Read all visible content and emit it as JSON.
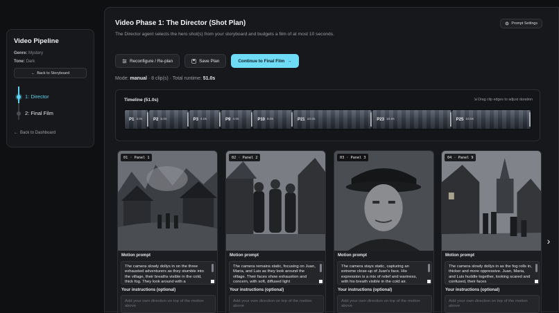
{
  "sidebar": {
    "title": "Video Pipeline",
    "genre_label": "Genre:",
    "genre": "Mystery",
    "tone_label": "Tone:",
    "tone": "Dark",
    "back_storyboard": "Back to Storyboard",
    "steps": [
      {
        "label": "1: Director",
        "active": true
      },
      {
        "label": "2: Final Film",
        "active": false
      }
    ],
    "back_dashboard": "Back to Dashboard"
  },
  "header": {
    "title": "Video Phase 1: The Director (Shot Plan)",
    "description": "The Director agent selects the hero shot(s) from your storyboard and budgets a film of at most 10 seconds.",
    "prompt_settings": "Prompt Settings"
  },
  "actions": {
    "reconfigure": "Reconfigure / Re-plan",
    "save": "Save Plan",
    "continue": "Continue to Final Film"
  },
  "status": {
    "mode_label": "Mode:",
    "mode": "manual",
    "clips": "8 clip(s)",
    "runtime_label": "Total runtime:",
    "runtime": "51.0s"
  },
  "timeline": {
    "title": "Timeline (51.0s)",
    "hint": "Drag clip edges to adjust duration",
    "clips": [
      {
        "name": "P1",
        "duration": "3.0s",
        "seconds": 3.0
      },
      {
        "name": "P2",
        "duration": "5.0s",
        "seconds": 5.0
      },
      {
        "name": "P3",
        "duration": "4.0s",
        "seconds": 4.0
      },
      {
        "name": "P9",
        "duration": "4.0s",
        "seconds": 4.0
      },
      {
        "name": "P10",
        "duration": "5.0s",
        "seconds": 5.0
      },
      {
        "name": "P21",
        "duration": "10.0s",
        "seconds": 10.0
      },
      {
        "name": "P23",
        "duration": "10.0s",
        "seconds": 10.0
      },
      {
        "name": "P25",
        "duration": "10.0s",
        "seconds": 10.0
      }
    ]
  },
  "cards": [
    {
      "badge": "01 · Panel 1",
      "motion_label": "Motion prompt",
      "motion": "The camera slowly dollys in on the three exhausted adventurers as they stumble into the village, their breaths visible in the cold, thick fog. They look around with a",
      "instructions_label": "Your instructions (optional)",
      "instructions_placeholder": "Add your own direction on top of the motion above"
    },
    {
      "badge": "02 · Panel 2",
      "motion_label": "Motion prompt",
      "motion": "The camera remains static, focusing on Juan, Maria, and Luis as they look around the village. Their faces show exhaustion and concern, with soft, diffused light",
      "instructions_label": "Your instructions (optional)",
      "instructions_placeholder": "Add your own direction on top of the motion above"
    },
    {
      "badge": "03 · Panel 3",
      "motion_label": "Motion prompt",
      "motion": "The camera stays static, capturing an extreme close-up of Juan's face. His expression is a mix of relief and wariness, with his breath visible in the cold air.",
      "instructions_label": "Your instructions (optional)",
      "instructions_placeholder": "Add your own direction on top of the motion above"
    },
    {
      "badge": "04 · Panel 9",
      "motion_label": "Motion prompt",
      "motion": "The camera slowly dollys in as the fog rolls in, thicker and more oppressive. Juan, Maria, and Luis huddle together, looking scared and confused, their faces",
      "instructions_label": "Your instructions (optional)",
      "instructions_placeholder": "Add your own direction on top of the motion above"
    }
  ],
  "colors": {
    "accent": "#5cd3f0",
    "primary_button": "#6fdcf7",
    "background": "#0f1012",
    "panel": "#17181b"
  }
}
